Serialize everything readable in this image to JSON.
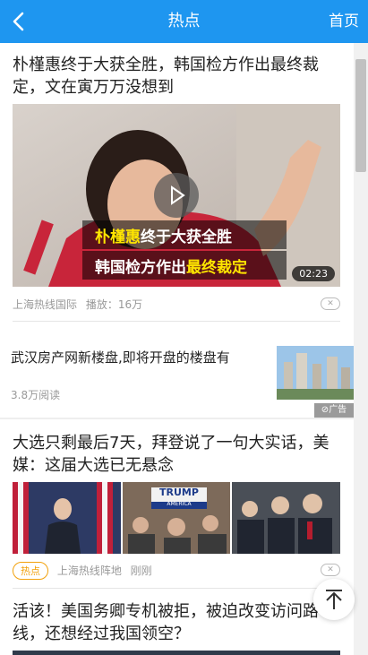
{
  "header": {
    "title": "热点",
    "home_label": "首页"
  },
  "articles": [
    {
      "headline": "朴槿惠终于大获全胜，韩国检方作出最终裁定，文在寅万万没想到",
      "video_caption_line1a": "朴槿惠",
      "video_caption_line1b": "终于大获全胜",
      "video_caption_line2a": "韩国检方作出",
      "video_caption_line2b": "最终裁定",
      "duration": "02:23",
      "source": "上海热线国际",
      "plays": "播放：16万"
    },
    {
      "headline": "武汉房产网新楼盘,即将开盘的楼盘有",
      "reads": "3.8万阅读",
      "ad_label": "广告"
    },
    {
      "headline": "大选只剩最后7天，拜登说了一句大实话，美媒：这届大选已无悬念",
      "sign_text1": "TRUMP",
      "sign_text2": "AMERICA",
      "tag": "热点",
      "source": "上海热线阵地",
      "time": "刚刚"
    },
    {
      "headline": "活该！美国务卿专机被拒，被迫改变访问路线，还想经过我国领空？"
    }
  ],
  "colors": {
    "header": "#1E96F0",
    "hot_tag": "#f2a10c",
    "caption_yellow": "#FFE600"
  }
}
